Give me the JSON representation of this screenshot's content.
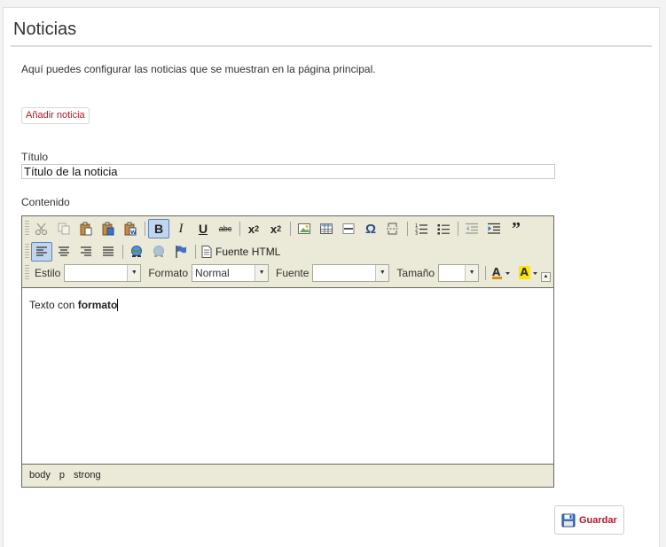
{
  "page": {
    "title": "Noticias",
    "intro": "Aquí puedes configurar las noticias que se muestran en la página principal."
  },
  "actions": {
    "add_news": "Añadir noticia",
    "save": "Guardar"
  },
  "form": {
    "title_label": "Título",
    "title_value": "Título de la noticia",
    "content_label": "Contenido"
  },
  "editor": {
    "source_label": "Fuente HTML",
    "style_label": "Estilo",
    "style_value": "",
    "format_label": "Formato",
    "format_value": "Normal",
    "font_label": "Fuente",
    "font_value": "",
    "size_label": "Tamaño",
    "size_value": "",
    "content_plain": "Texto con ",
    "content_bold": "formato",
    "path": [
      "body",
      "p",
      "strong"
    ]
  },
  "colors": {
    "accent": "#b5162a",
    "toolbar_bg": "#ebe9d7",
    "active_button": "#c2d5ee"
  }
}
